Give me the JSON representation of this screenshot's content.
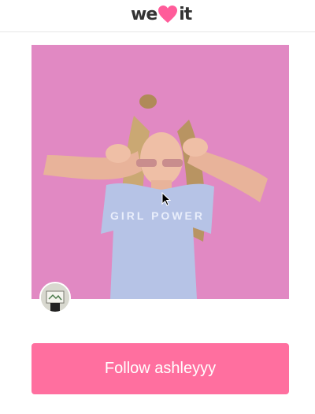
{
  "header": {
    "logo_prefix": "we",
    "logo_suffix": "it",
    "logo_icon": "heart-icon",
    "brand_color": "#ff6f9f"
  },
  "post": {
    "image_alt": "",
    "image_icon": "photo-image",
    "shirt_text": "GIRL POWER",
    "avatar_icon": "user-avatar"
  },
  "actions": {
    "follow_label": "Follow ashleyyy"
  }
}
